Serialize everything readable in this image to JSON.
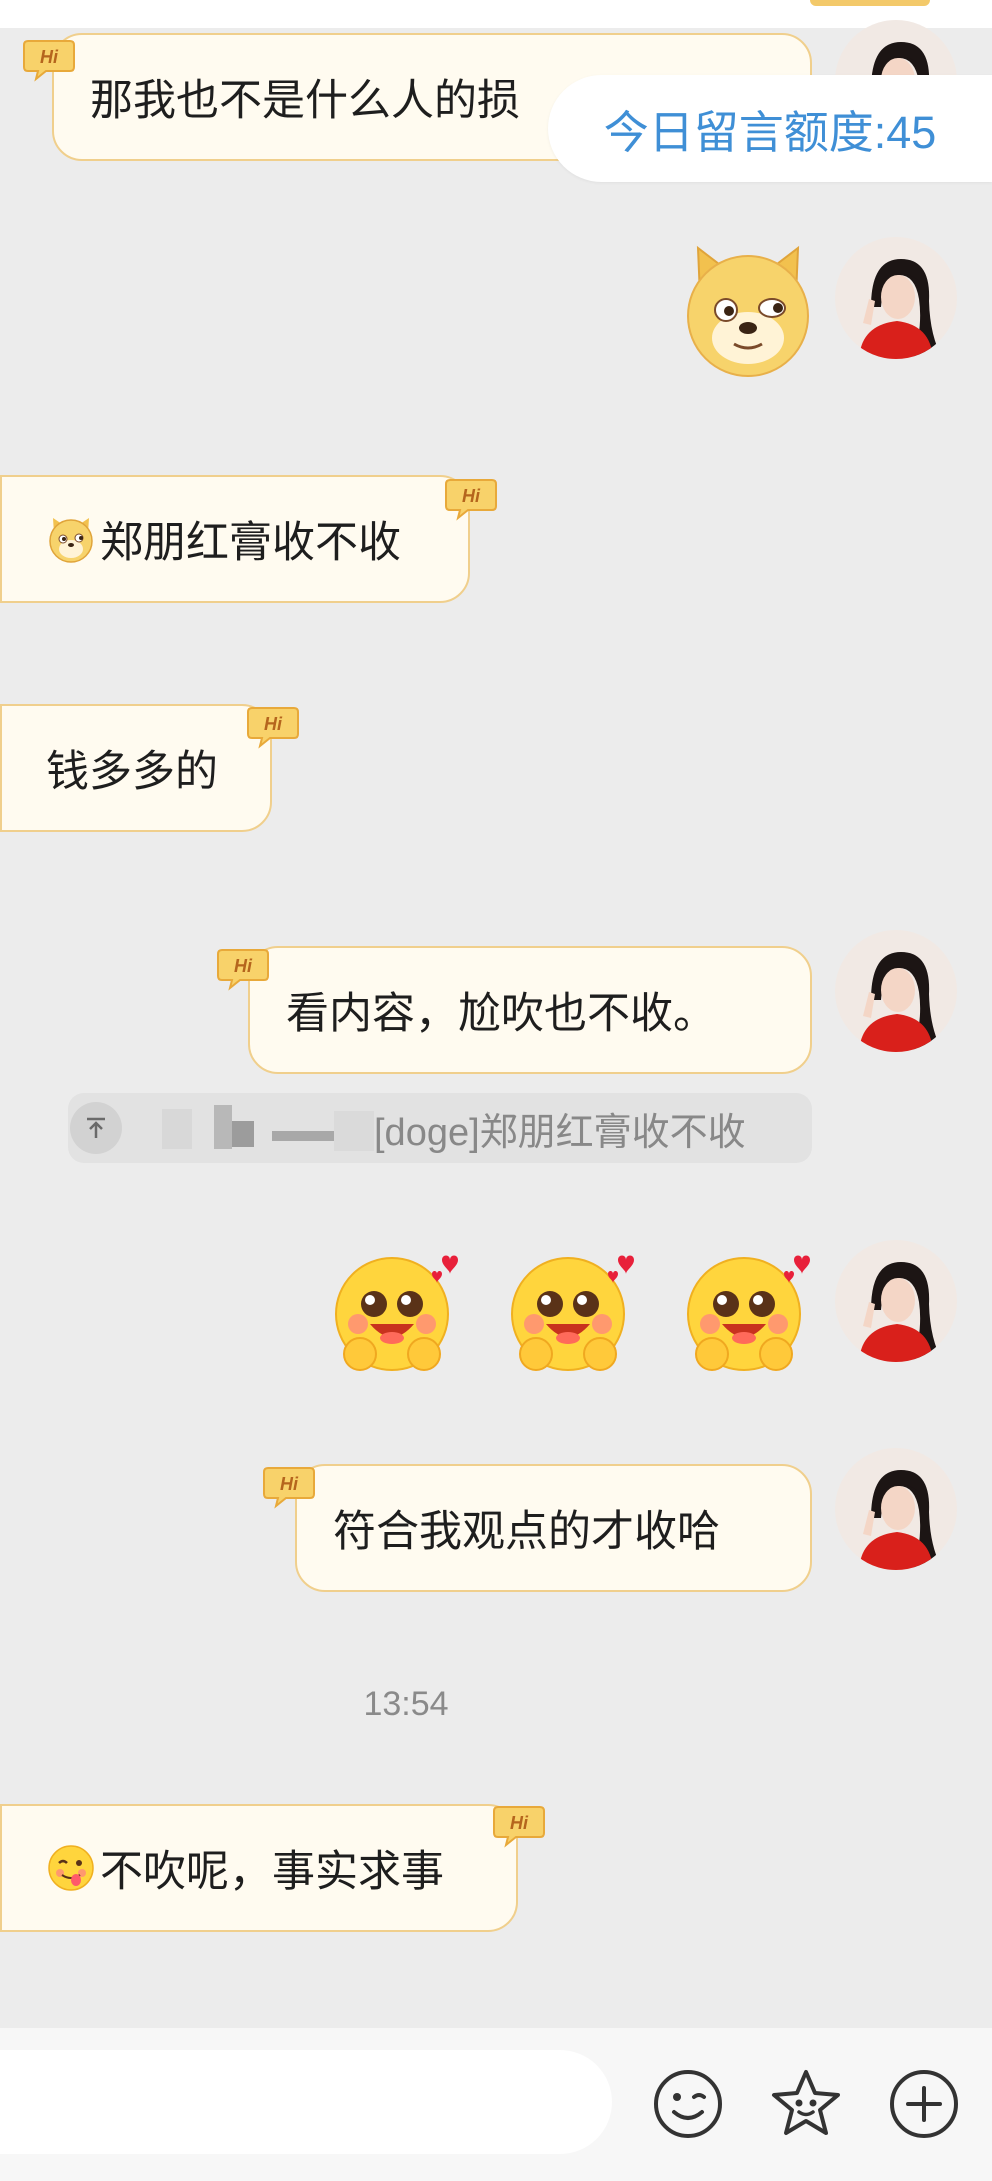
{
  "quota": {
    "label": "今日留言额度:45"
  },
  "messages": {
    "m1": "那我也不是什么人的损",
    "m2": "郑朋红膏收不收",
    "m3": "钱多多的",
    "m4": "看内容，尬吹也不收。",
    "m5": "符合我观点的才收哈",
    "m6": "不吹呢，事实求事"
  },
  "quote": {
    "text": "[doge]郑朋红膏收不收",
    "icon": "quote-top-arrow-icon"
  },
  "time": "13:54",
  "bubble_badge": "Hi",
  "icons": {
    "doge": "doge-emoji",
    "happy": "happy-blush-emoji",
    "tongue": "tongue-emoji",
    "bottom": [
      "wink-face-icon",
      "star-face-icon",
      "plus-circle-icon"
    ]
  },
  "colors": {
    "background": "#ececec",
    "bubble_fill": "#fffbf0",
    "bubble_border": "#f0cf8c",
    "quota_text": "#3f8fd6",
    "avatar_red": "#d9201b"
  }
}
